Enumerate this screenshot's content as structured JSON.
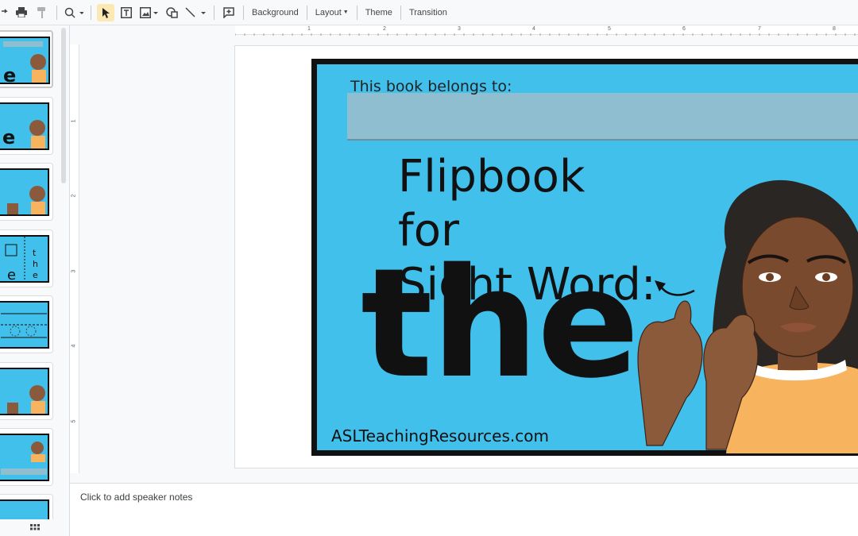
{
  "toolbar": {
    "background_label": "Background",
    "layout_label": "Layout",
    "theme_label": "Theme",
    "transition_label": "Transition"
  },
  "ruler": {
    "horizontal_numbers": [
      "1",
      "2",
      "3",
      "4",
      "5",
      "6",
      "7",
      "8"
    ],
    "vertical_numbers": [
      "1",
      "2",
      "3",
      "4",
      "5"
    ]
  },
  "slide": {
    "belongs_text": "This book belongs to:",
    "title_line1": "Flipbook for",
    "title_line2": "Sight Word:",
    "sight_word": "the",
    "website": "ASLTeachingResources.com"
  },
  "notes": {
    "placeholder": "Click to add speaker notes"
  },
  "colors": {
    "slide_blue": "#41c0ec",
    "accent_yellow": "#fce8b2"
  }
}
